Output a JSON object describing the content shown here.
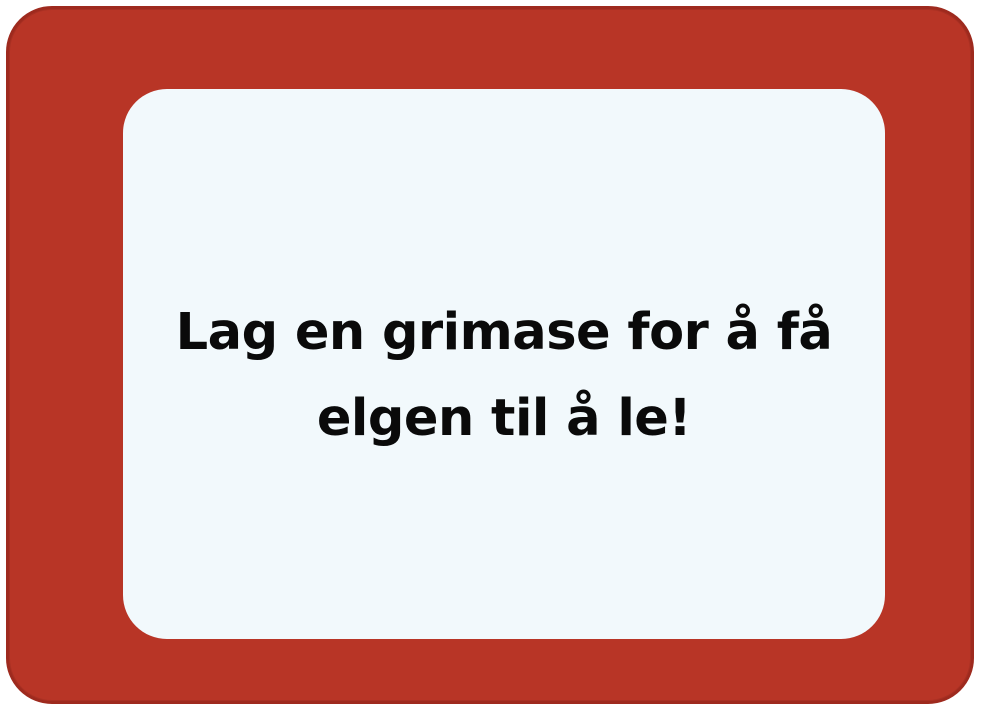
{
  "card": {
    "text": "Lag en grimase for å få elgen til å le!",
    "frame_color": "#b83526",
    "panel_color": "#f2f9fc",
    "text_color": "#0a0a0a"
  }
}
